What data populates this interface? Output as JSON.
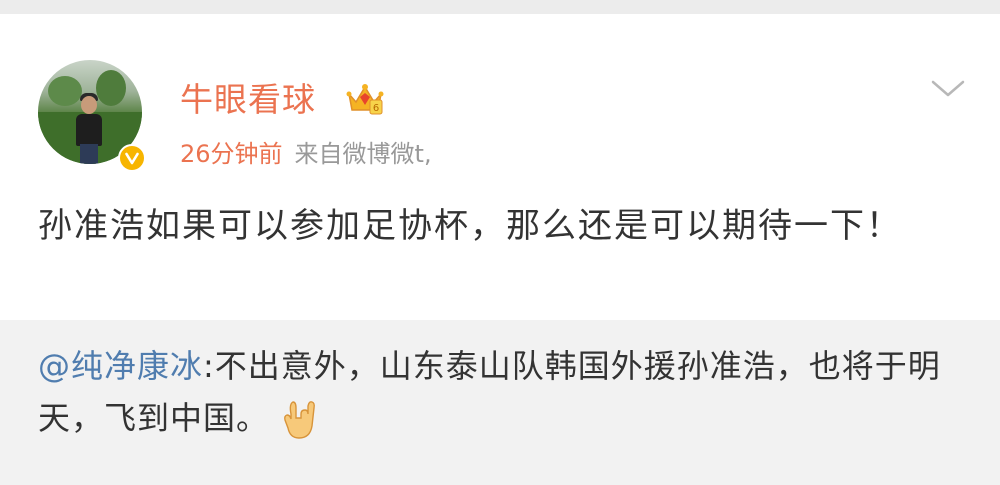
{
  "top": {},
  "post": {
    "username": "牛眼看球",
    "time": "26分钟前",
    "source": "来自微博微t,",
    "content": "孙准浩如果可以参加足协杯，那么还是可以期待一下！",
    "icons": {
      "avatar": "avatar",
      "verified": "verified-badge",
      "vip": "crown-icon",
      "menu": "chevron-down-icon"
    }
  },
  "repost": {
    "mention": "@纯净康冰",
    "text": ":不出意外，山东泰山队韩国外援孙准浩，也将于明天，飞到中国。",
    "emoji": "rock-hand-emoji"
  },
  "colors": {
    "accent": "#eb7350",
    "link": "#507daf",
    "text": "#333333",
    "meta": "#999999",
    "background": "#f2f2f2"
  }
}
